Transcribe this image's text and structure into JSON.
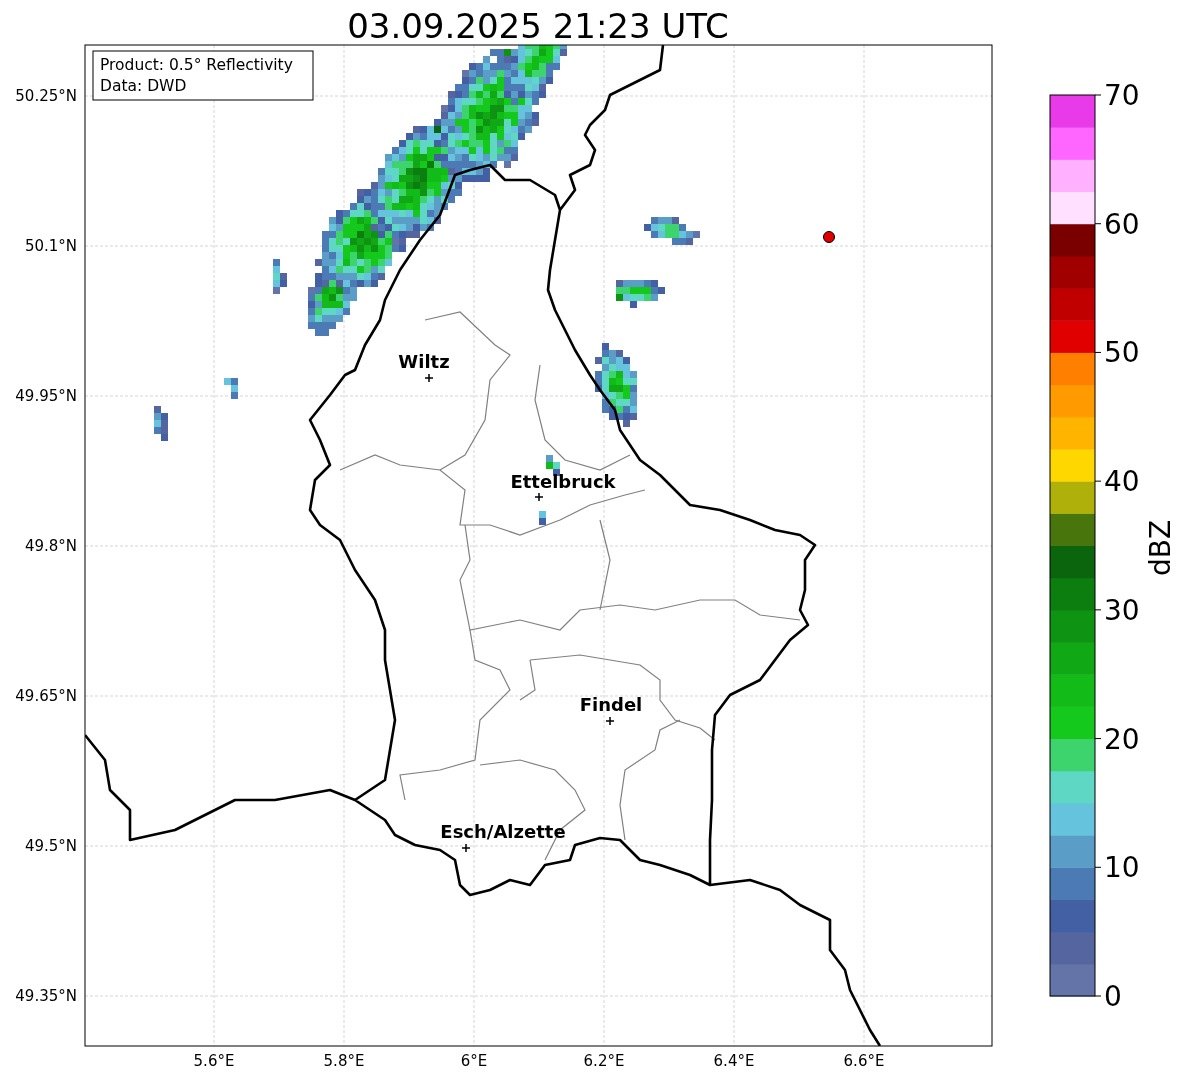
{
  "title": "03.09.2025 21:23 UTC",
  "info_box": {
    "lines": [
      "Product: 0.5° Reflectivity",
      "Data: DWD"
    ]
  },
  "map": {
    "lat_ticks": [
      "50.25°N",
      "50.1°N",
      "49.95°N",
      "49.8°N",
      "49.65°N",
      "49.5°N",
      "49.35°N"
    ],
    "lon_ticks": [
      "5.6°E",
      "5.8°E",
      "6°E",
      "6.2°E",
      "6.4°E",
      "6.6°E"
    ],
    "cities": [
      {
        "name": "Wiltz"
      },
      {
        "name": "Ettelbruck"
      },
      {
        "name": "Findel"
      },
      {
        "name": "Esch/Alzette"
      }
    ]
  },
  "colorbar": {
    "label": "dBZ",
    "ticks": [
      "70",
      "60",
      "50",
      "40",
      "30",
      "20",
      "10",
      "0"
    ],
    "segments": [
      {
        "color": "#6474a8"
      },
      {
        "color": "#5465a0"
      },
      {
        "color": "#4460a5"
      },
      {
        "color": "#4b7ab4"
      },
      {
        "color": "#5a9ec8"
      },
      {
        "color": "#66c3de"
      },
      {
        "color": "#5ed8c4"
      },
      {
        "color": "#3dd46e"
      },
      {
        "color": "#14c81c"
      },
      {
        "color": "#12bb18"
      },
      {
        "color": "#10a815"
      },
      {
        "color": "#0e9312"
      },
      {
        "color": "#0c7e10"
      },
      {
        "color": "#0a650c"
      },
      {
        "color": "#48760c"
      },
      {
        "color": "#b0b00a"
      },
      {
        "color": "#ffd700"
      },
      {
        "color": "#ffb400"
      },
      {
        "color": "#ff9a00"
      },
      {
        "color": "#ff7f00"
      },
      {
        "color": "#e00000"
      },
      {
        "color": "#c00000"
      },
      {
        "color": "#a00000"
      },
      {
        "color": "#7a0000"
      },
      {
        "color": "#ffe0ff"
      },
      {
        "color": "#ffb0ff"
      },
      {
        "color": "#ff66ff"
      },
      {
        "color": "#e83ae8"
      }
    ]
  }
}
